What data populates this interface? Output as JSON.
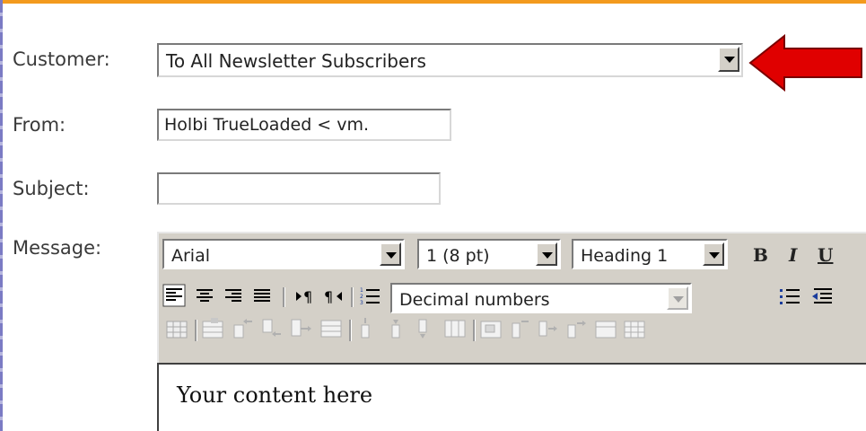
{
  "form": {
    "customer_label": "Customer:",
    "customer_value": "To All Newsletter Subscribers",
    "from_label": "From:",
    "from_value": "Holbi TrueLoaded < vm.",
    "subject_label": "Subject:",
    "subject_value": "",
    "message_label": "Message:"
  },
  "editor": {
    "font_value": "Arial",
    "size_value": "1 (8 pt)",
    "heading_value": "Heading 1",
    "bold_label": "B",
    "italic_label": "I",
    "underline_label": "U",
    "list_style_value": "Decimal numbers",
    "content_text": "Your content here"
  },
  "colors": {
    "top_rule": "#f39a1e",
    "arrow": "#e00000",
    "toolbar_bg": "#d4d0c8"
  },
  "icons": [
    "align-left-icon",
    "align-center-icon",
    "align-right-icon",
    "align-justify-icon",
    "ltr-icon",
    "rtl-icon",
    "ordered-list-icon",
    "unordered-list-icon",
    "outdent-icon",
    "table-icons"
  ]
}
